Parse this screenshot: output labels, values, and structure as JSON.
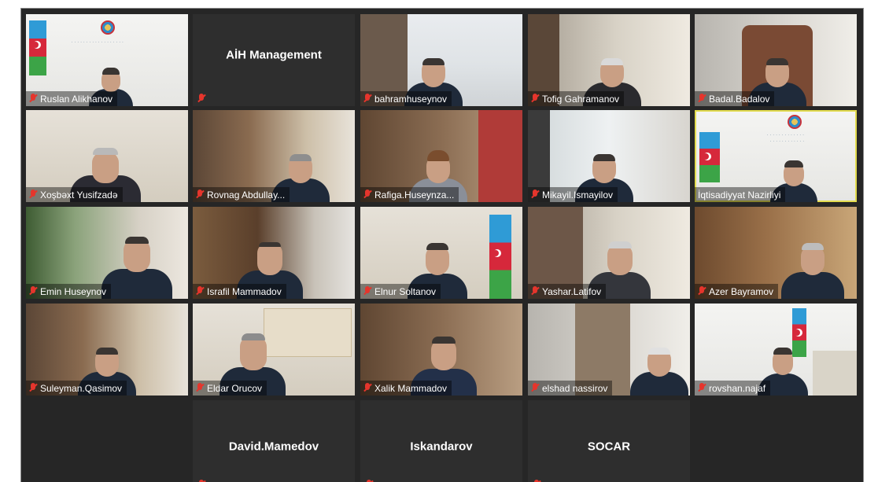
{
  "window": {
    "title": ""
  },
  "participants": [
    {
      "name": "Ruslan Alikhanov",
      "muted": true,
      "video": true
    },
    {
      "name": "AİH Management",
      "muted": true,
      "video": false
    },
    {
      "name": "bahramhuseynov",
      "muted": true,
      "video": true
    },
    {
      "name": "Tofig Gahramanov",
      "muted": true,
      "video": true
    },
    {
      "name": "Badal.Badalov",
      "muted": true,
      "video": true
    },
    {
      "name": "Xoşbəxt Yusifzadə",
      "muted": true,
      "video": true
    },
    {
      "name": "Rovnag Abdullay...",
      "muted": true,
      "video": true
    },
    {
      "name": "Rafiga.Huseynza...",
      "muted": true,
      "video": true
    },
    {
      "name": "Mikayil.Ismayilov",
      "muted": true,
      "video": true
    },
    {
      "name": "İqtisadiyyat Nazirliyi",
      "muted": false,
      "video": true,
      "speaking": true
    },
    {
      "name": "Emin Huseynov",
      "muted": true,
      "video": true
    },
    {
      "name": "Israfil Mammadov",
      "muted": true,
      "video": true
    },
    {
      "name": "Elnur Soltanov",
      "muted": true,
      "video": true
    },
    {
      "name": "Yashar.Latifov",
      "muted": true,
      "video": true
    },
    {
      "name": "Azer Bayramov",
      "muted": true,
      "video": true
    },
    {
      "name": "Suleyman.Qasimov",
      "muted": true,
      "video": true
    },
    {
      "name": "Eldar Orucov",
      "muted": true,
      "video": true
    },
    {
      "name": "Xalik Mammadov",
      "muted": true,
      "video": true
    },
    {
      "name": "elshad nassirov",
      "muted": true,
      "video": true
    },
    {
      "name": "rovshan.najaf",
      "muted": true,
      "video": true
    },
    {
      "name": "David.Mamedov",
      "muted": true,
      "video": false
    },
    {
      "name": "Iskandarov",
      "muted": true,
      "video": false
    },
    {
      "name": "SOCAR",
      "muted": true,
      "video": false
    }
  ],
  "icons": {
    "muted": "mic-muted-icon"
  },
  "colors": {
    "grid_bg": "#262626",
    "speaker_border": "#e3dc4f",
    "muted_icon": "#e5352c"
  }
}
